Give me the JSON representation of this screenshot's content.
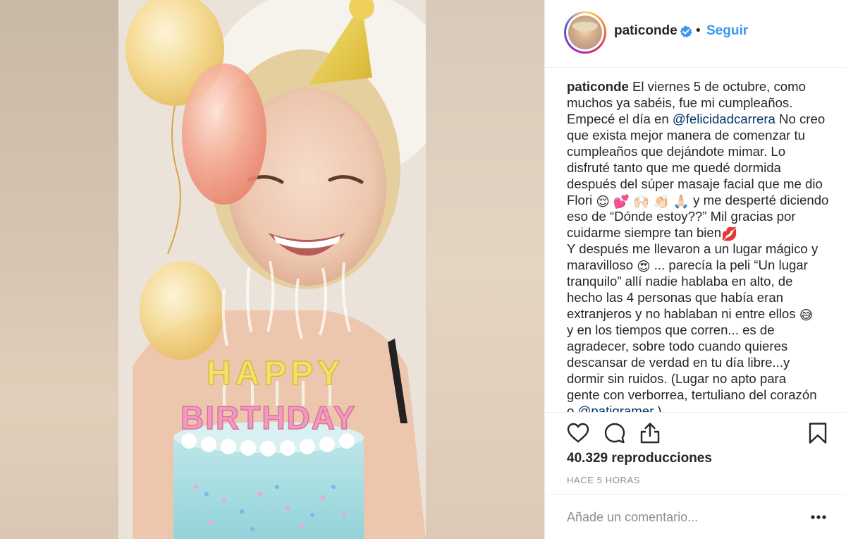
{
  "post": {
    "username": "paticonde",
    "dot": "•",
    "follow_label": "Seguir",
    "caption": {
      "l1_user": "paticonde",
      "l1_text": " El viernes 5 de octubre, como",
      "l2": "muchos ya sabéis, fue mi cumpleaños.",
      "l3_pre": "Empecé el día en ",
      "l3_mention": "@felicidadcarrera",
      "l3_post": " No creo",
      "l4": "que exista mejor manera de comenzar tu",
      "l5": "cumpleaños que dejándote mimar. Lo",
      "l6": "disfruté tanto que me quedé dormida",
      "l7": "después del súper masaje facial que me dio",
      "l8_pre": "Flori ",
      "l8_emojis": "😌 💕 🙌🏻 👏🏻 🙏🏻",
      "l8_post": "  y me desperté diciendo",
      "l9": "eso de “Dónde estoy??” Mil gracias por",
      "l10_pre": "cuidarme siempre tan bien",
      "l10_emoji": "💋",
      "l11": "Y después me llevaron a un lugar mágico y",
      "l12_pre": "maravilloso ",
      "l12_emoji": "😍",
      "l12_post": " ... parecía la peli “Un lugar",
      "l13": "tranquilo” allí nadie hablaba en alto, de",
      "l14": "hecho las 4 personas que había eran",
      "l15_pre": "extranjeros y no hablaban ni entre ellos ",
      "l15_emoji": "😅",
      "l16": "y en los tiempos que corren... es de",
      "l17": "agradecer, sobre todo cuando quieres",
      "l18": "descansar de verdad en tu día libre...y",
      "l19": "dormir sin ruidos. (Lugar no apto para",
      "l20": "gente con verborrea, tertuliano del corazón",
      "l21_pre": "o ",
      "l21_mention": "@patigramer",
      "l21_post": " )"
    },
    "views": "40.329 reproducciones",
    "timestamp": "HACE 5 HORAS",
    "comment_placeholder": "Añade un comentario..."
  },
  "media": {
    "cake_letters_top": "HAPPY",
    "cake_letters_bottom": "BIRTHDAY"
  },
  "icons": {
    "like": "heart-icon",
    "comment": "comment-icon",
    "share": "share-icon",
    "save": "bookmark-icon",
    "more": "more-options-icon",
    "verified": "verified-badge-icon"
  },
  "colors": {
    "follow": "#3897f0",
    "mention": "#003569",
    "verified": "#3897f0",
    "timestamp": "#8e8e8e"
  }
}
